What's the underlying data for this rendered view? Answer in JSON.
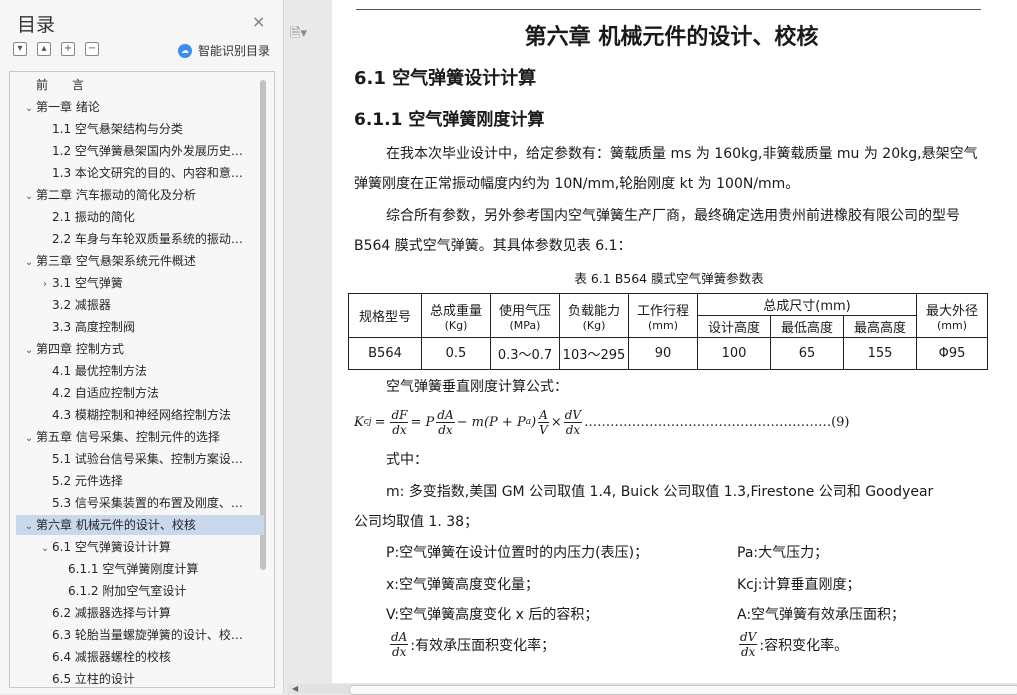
{
  "nav": {
    "title": "目录",
    "close": "×",
    "tools": [
      "▾",
      "▴",
      "+",
      "−"
    ],
    "smart_label": "智能识别目录",
    "smart_icon": "cloud-icon",
    "items": [
      {
        "label": "前　　言",
        "level": 0,
        "toggle": ""
      },
      {
        "label": "第一章 绪论",
        "level": 0,
        "toggle": "⌄"
      },
      {
        "label": "1.1 空气悬架结构与分类",
        "level": 1,
        "toggle": ""
      },
      {
        "label": "1.2 空气弹簧悬架国内外发展历史…",
        "level": 1,
        "toggle": ""
      },
      {
        "label": "1.3 本论文研究的目的、内容和意…",
        "level": 1,
        "toggle": ""
      },
      {
        "label": "第二章 汽车振动的简化及分析",
        "level": 0,
        "toggle": "⌄"
      },
      {
        "label": "2.1 振动的简化",
        "level": 1,
        "toggle": ""
      },
      {
        "label": "2.2 车身与车轮双质量系统的振动…",
        "level": 1,
        "toggle": ""
      },
      {
        "label": "第三章 空气悬架系统元件概述",
        "level": 0,
        "toggle": "⌄"
      },
      {
        "label": "3.1 空气弹簧",
        "level": 1,
        "toggle": "›"
      },
      {
        "label": "3.2 减振器",
        "level": 1,
        "toggle": ""
      },
      {
        "label": "3.3 高度控制阀",
        "level": 1,
        "toggle": ""
      },
      {
        "label": "第四章 控制方式",
        "level": 0,
        "toggle": "⌄"
      },
      {
        "label": "4.1 最优控制方法",
        "level": 1,
        "toggle": ""
      },
      {
        "label": "4.2 自适应控制方法",
        "level": 1,
        "toggle": ""
      },
      {
        "label": "4.3 模糊控制和神经网络控制方法",
        "level": 1,
        "toggle": ""
      },
      {
        "label": "第五章 信号采集、控制元件的选择",
        "level": 0,
        "toggle": "⌄"
      },
      {
        "label": "5.1 试验台信号采集、控制方案设…",
        "level": 1,
        "toggle": ""
      },
      {
        "label": "5.2 元件选择",
        "level": 1,
        "toggle": ""
      },
      {
        "label": "5.3 信号采集装置的布置及刚度、…",
        "level": 1,
        "toggle": ""
      },
      {
        "label": "第六章 机械元件的设计、校核",
        "level": 0,
        "toggle": "⌄",
        "selected": true
      },
      {
        "label": "6.1 空气弹簧设计计算",
        "level": 1,
        "toggle": "⌄"
      },
      {
        "label": "6.1.1 空气弹簧刚度计算",
        "level": 2,
        "toggle": ""
      },
      {
        "label": "6.1.2 附加空气室设计",
        "level": 2,
        "toggle": ""
      },
      {
        "label": "6.2 减振器选择与计算",
        "level": 1,
        "toggle": ""
      },
      {
        "label": "6.3 轮胎当量螺旋弹簧的设计、校…",
        "level": 1,
        "toggle": ""
      },
      {
        "label": "6.4 减振器螺栓的校核",
        "level": 1,
        "toggle": ""
      },
      {
        "label": "6.5 立柱的设计",
        "level": 1,
        "toggle": ""
      }
    ]
  },
  "doc": {
    "chapter": "第六章 机械元件的设计、校核",
    "h2": "6.1 空气弹簧设计计算",
    "h3": "6.1.1 空气弹簧刚度计算",
    "para1": "在我本次毕业设计中，给定参数有：簧载质量 ms 为 160kg,非簧载质量 mu 为 20kg,悬架空气弹簧刚度在正常振动幅度内约为 10N/mm,轮胎刚度 kt 为 100N/mm。",
    "para2": "综合所有参数，另外参考国内空气弹簧生产厂商，最终确定选用贵州前进橡胶有限公司的型号 B564 膜式空气弹簧。其具体参数见表 6.1：",
    "table_caption": "表 6.1 B564 膜式空气弹簧参数表",
    "table": {
      "h_model": "规格型号",
      "h_weight": "总成重量",
      "u_weight": "(Kg)",
      "h_pressure": "使用气压",
      "u_pressure": "(MPa)",
      "h_load": "负载能力",
      "u_load": "(Kg)",
      "h_stroke": "工作行程",
      "u_stroke": "(mm)",
      "h_size": "总成尺寸(mm)",
      "h_design": "设计高度",
      "h_min": "最低高度",
      "h_max": "最高高度",
      "h_dia": "最大外径",
      "u_dia": "(mm)",
      "row": [
        "B564",
        "0.5",
        "0.3～0.7",
        "103～295",
        "90",
        "100",
        "65",
        "155",
        "Φ95"
      ]
    },
    "formula_intro": "空气弹簧垂直刚度计算公式：",
    "formula": {
      "lhs": "K",
      "lhs_sub": "cj",
      "eq": "=",
      "f1n": "dF",
      "f1d": "dx",
      "eq2": "= P",
      "f2n": "dA",
      "f2d": "dx",
      "mid": "− m(P + P",
      "mid_sub": "a",
      "mid_end": ")",
      "f3n": "A",
      "f3d": "V",
      "times": "×",
      "f4n": "dV",
      "f4d": "dx",
      "dots": "…………………………………………………",
      "num": "(9)"
    },
    "where": "式中：",
    "m_line1": "m: 多变指数,美国 GM 公司取值 1.4, Buick 公司取值 1.3,Firestone 公司和 Goodyear",
    "m_line2": "公司均取值 1. 38；",
    "defs": [
      {
        "left": "P:空气弹簧在设计位置时的内压力(表压)；",
        "right": "Pa:大气压力；"
      },
      {
        "left": "x:空气弹簧高度变化量；",
        "right": "Kcj:计算垂直刚度；"
      },
      {
        "left": "V:空气弹簧高度变化 x 后的容积；",
        "right": "A:空气弹簧有效承压面积；"
      }
    ],
    "frac_defs": {
      "l_num": "dA",
      "l_den": "dx",
      "l_text": ":有效承压面积变化率；",
      "r_num": "dV",
      "r_den": "dx",
      "r_text": ":容积变化率。"
    },
    "gutter_icon": "page-icon"
  }
}
